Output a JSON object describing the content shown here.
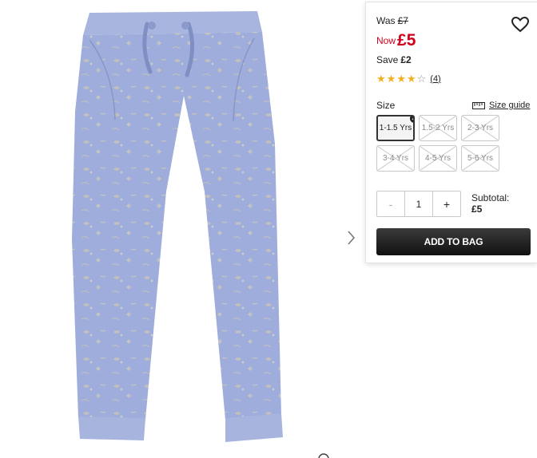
{
  "price": {
    "was_label": "Was",
    "was_value": "£7",
    "now_label": "Now",
    "now_value": "£5",
    "save_label": "Save",
    "save_value": "£2"
  },
  "rating": {
    "stars": 4,
    "out_of": 5,
    "review_count": "(4)"
  },
  "size": {
    "label": "Size",
    "guide_label": "Size guide",
    "options": [
      {
        "label": "1-1.5 Yrs",
        "selected": true,
        "available": true
      },
      {
        "label": "1.5-2 Yrs",
        "selected": false,
        "available": false
      },
      {
        "label": "2-3 Yrs",
        "selected": false,
        "available": false
      },
      {
        "label": "3-4 Yrs",
        "selected": false,
        "available": false
      },
      {
        "label": "4-5 Yrs",
        "selected": false,
        "available": false
      },
      {
        "label": "5-6 Yrs",
        "selected": false,
        "available": false
      }
    ]
  },
  "quantity": {
    "minus": "-",
    "value": "1",
    "plus": "+"
  },
  "subtotal": {
    "label": "Subtotal:",
    "value": "£5"
  },
  "cta": {
    "add_to_bag": "ADD TO BAG"
  },
  "colors": {
    "price_red": "#d0021b",
    "star_gold": "#f2b01e",
    "product_blue": "#9aa9d6",
    "button_dark": "#1a1a1a"
  },
  "icons": {
    "wishlist": "heart-icon",
    "next": "chevron-right-icon",
    "size_guide": "ruler-icon",
    "zoom": "zoom-icon"
  }
}
